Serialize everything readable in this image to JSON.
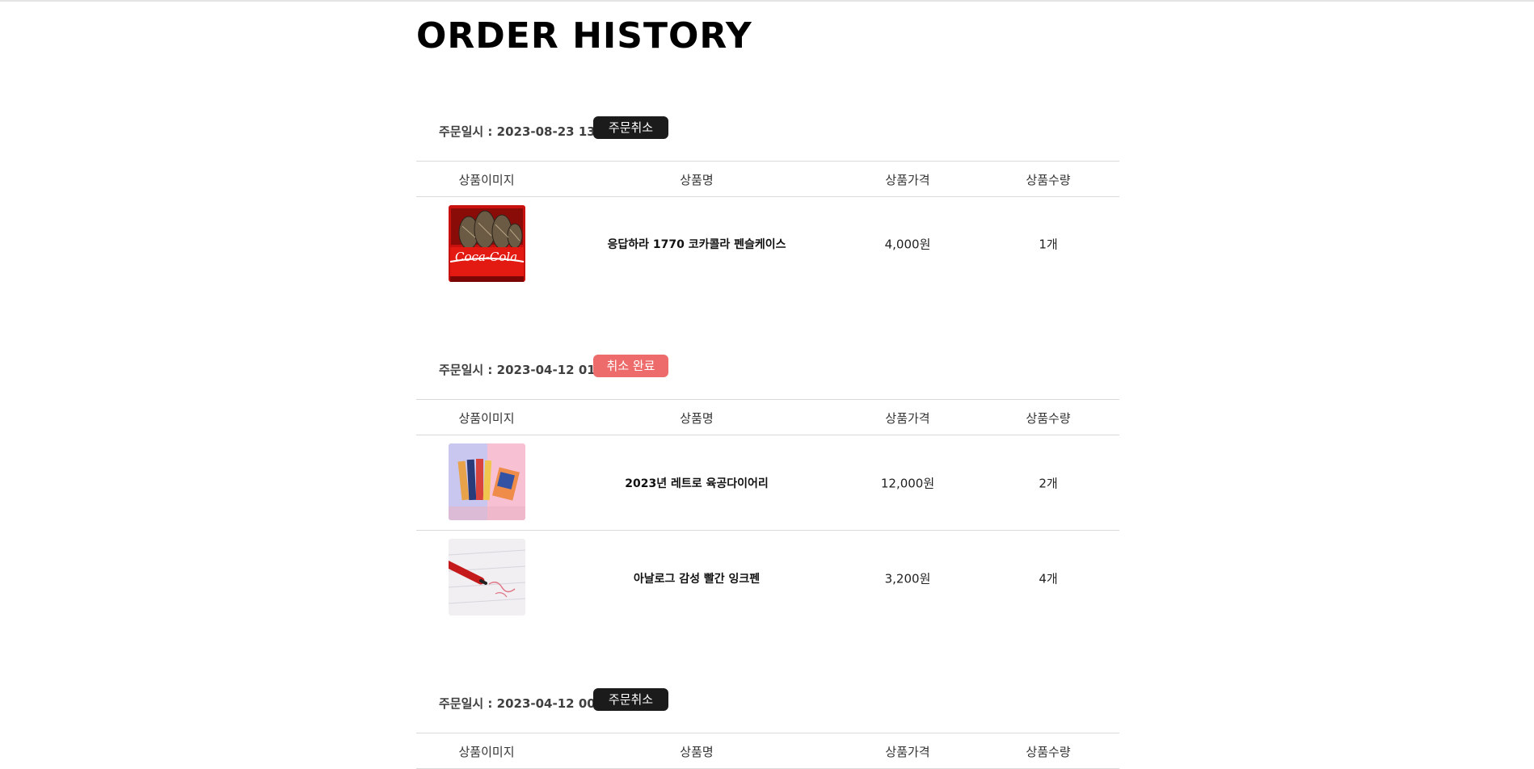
{
  "page": {
    "title": "ORDER HISTORY"
  },
  "columns": [
    "상품이미지",
    "상품명",
    "상품가격",
    "상품수량"
  ],
  "orders": [
    {
      "date_label": "주문일시 : 2023-08-23 13:26",
      "button": "주문취소",
      "items": [
        {
          "image": "cocacola-pencil-case-image",
          "name": "응답하라 1770 코카콜라 펜슬케이스",
          "price": "4,000원",
          "qty": "1개"
        }
      ]
    },
    {
      "date_label": "주문일시 : 2023-04-12 01:48",
      "button": "취소 완료",
      "items": [
        {
          "image": "retro-diary-image",
          "name": "2023년 레트로 육공다이어리",
          "price": "12,000원",
          "qty": "2개"
        },
        {
          "image": "red-ink-pen-image",
          "name": "아날로그 감성 빨간 잉크펜",
          "price": "3,200원",
          "qty": "4개"
        }
      ]
    },
    {
      "date_label": "주문일시 : 2023-04-12 00:36",
      "button": "주문취소",
      "items": []
    }
  ],
  "colors": {
    "cancel_button": "#1b1b1b",
    "cancelled_button": "#ee6b6b"
  }
}
